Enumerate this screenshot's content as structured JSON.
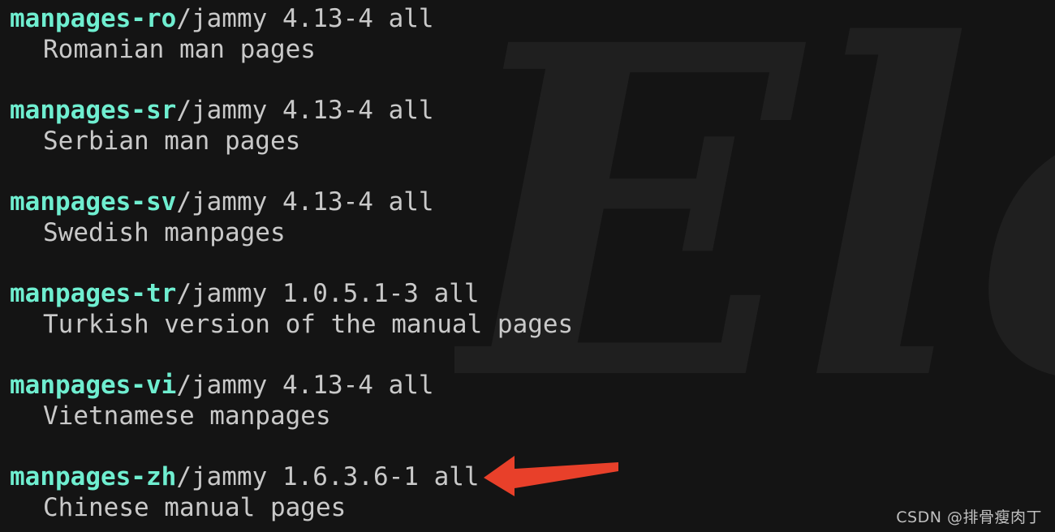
{
  "terminal": {
    "background_color": "#141414",
    "package_name_color": "#6feed0",
    "text_color": "#c9c9c9",
    "entries": [
      {
        "name": "manpages-ro",
        "meta": "/jammy 4.13-4 all",
        "suite": "jammy",
        "version": "4.13-4",
        "architecture": "all",
        "description": "Romanian man pages"
      },
      {
        "name": "manpages-sr",
        "meta": "/jammy 4.13-4 all",
        "suite": "jammy",
        "version": "4.13-4",
        "architecture": "all",
        "description": "Serbian man pages"
      },
      {
        "name": "manpages-sv",
        "meta": "/jammy 4.13-4 all",
        "suite": "jammy",
        "version": "4.13-4",
        "architecture": "all",
        "description": "Swedish manpages"
      },
      {
        "name": "manpages-tr",
        "meta": "/jammy 1.0.5.1-3 all",
        "suite": "jammy",
        "version": "1.0.5.1-3",
        "architecture": "all",
        "description": "Turkish version of the manual pages"
      },
      {
        "name": "manpages-vi",
        "meta": "/jammy 4.13-4 all",
        "suite": "jammy",
        "version": "4.13-4",
        "architecture": "all",
        "description": "Vietnamese manpages"
      },
      {
        "name": "manpages-zh",
        "meta": "/jammy 1.6.3.6-1 all",
        "suite": "jammy",
        "version": "1.6.3.6-1",
        "architecture": "all",
        "description": "Chinese manual pages"
      }
    ]
  },
  "annotation": {
    "arrow_color": "#e8402a",
    "arrow_direction": "left",
    "points_at": "manpages-zh"
  },
  "background_watermark": {
    "text": "Elec",
    "color": "#1f1f1f"
  },
  "csdn_watermark": {
    "text": "CSDN @排骨瘦肉丁",
    "color": "#cfcfcf"
  }
}
